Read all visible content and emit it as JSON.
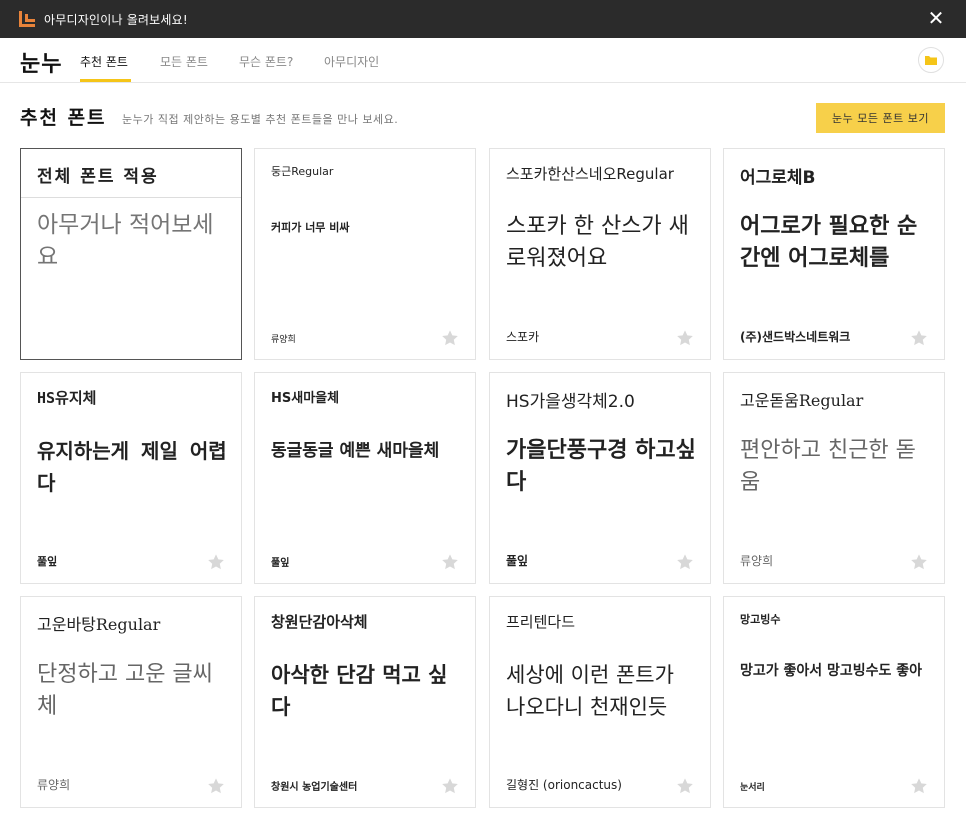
{
  "topbar": {
    "message": "아무디자인이나 올려보세요!",
    "close_glyph": "✕"
  },
  "nav": {
    "brand": "눈누",
    "tabs": [
      "추천 폰트",
      "모든 폰트",
      "무슨 폰트?",
      "아무디자인"
    ]
  },
  "header": {
    "title": "추천 폰트",
    "description": "눈누가 직접 제안하는 용도별 추천 폰트들을 만나 보세요.",
    "all_fonts_button": "눈누 모든 폰트 보기"
  },
  "apply_card": {
    "title": "전체 폰트 적용",
    "placeholder": "아무거나 적어보세요"
  },
  "fonts": [
    {
      "name": "둥근Regular",
      "sample": "커피가 너무 비싸",
      "author": "류양희"
    },
    {
      "name": "스포카한산스네오Regular",
      "sample": "스포카 한 산스가 새로워졌어요",
      "author": "스포카"
    },
    {
      "name": "어그로체B",
      "sample": "어그로가 필요한 순간엔 어그로체를",
      "author": "(주)샌드박스네트워크"
    },
    {
      "name": "HS유지체",
      "sample": "유지하는게 제일 어렵다",
      "author": "풀잎"
    },
    {
      "name": "HS새마을체",
      "sample": "동글동글 예쁜 새마을체",
      "author": "풀잎"
    },
    {
      "name": "HS가을생각체2.0",
      "sample": "가을단풍구경 하고싶다",
      "author": "풀잎"
    },
    {
      "name": "고운돋움Regular",
      "sample": "편안하고 친근한 돋움",
      "author": "류양희"
    },
    {
      "name": "고운바탕Regular",
      "sample": "단정하고 고운 글씨체",
      "author": "류양희"
    },
    {
      "name": "창원단감아삭체",
      "sample": "아삭한 단감 먹고 싶다",
      "author": "창원시 농업기술센터"
    },
    {
      "name": "프리텐다드",
      "sample": "세상에 이런 폰트가 나오다니 천재인듯",
      "author": "길형진 (orioncactus)"
    },
    {
      "name": "망고빙수",
      "sample": "망고가 좋아서 망고빙수도 좋아",
      "author": "눈서리"
    }
  ],
  "colors": {
    "accent": "#f7d04a",
    "topbar_bg": "#2b2b2b",
    "logo": "#e8833a",
    "star": "#d8d8d8"
  },
  "icons": {
    "logo": "nunu-logo-icon",
    "close": "close-icon",
    "avatar": "folder-icon",
    "favorite": "star-icon"
  }
}
